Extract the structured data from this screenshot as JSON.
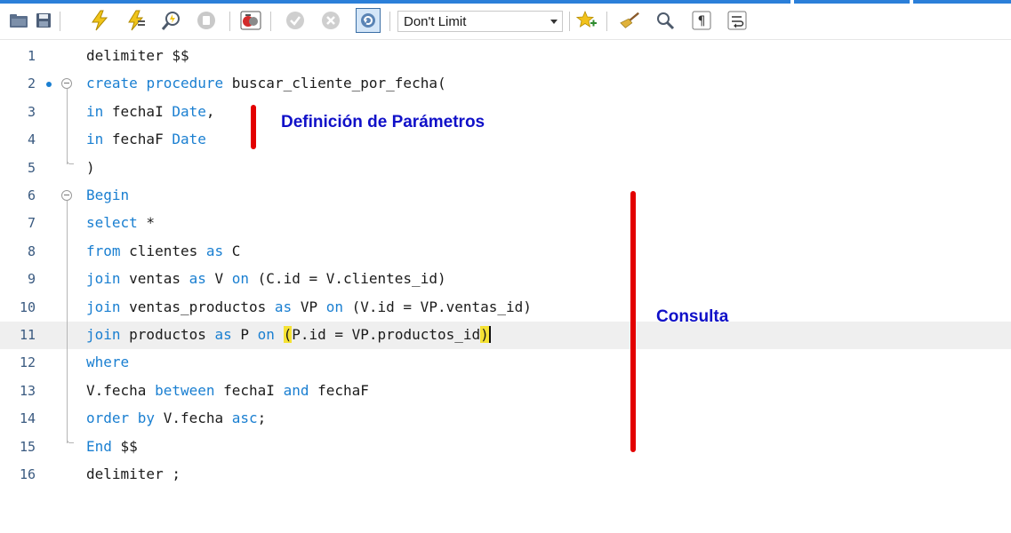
{
  "toolbar": {
    "limit_select_value": "Don't Limit",
    "icons": [
      "open-folder-icon",
      "save-icon",
      "execute-icon",
      "execute-current-icon",
      "explain-icon",
      "stop-icon",
      "toggle-errors-icon",
      "commit-icon",
      "rollback-icon",
      "autocommit-icon",
      "add-snippet-icon",
      "beautify-icon",
      "find-icon",
      "invisible-chars-icon",
      "wrap-lines-icon"
    ]
  },
  "editor": {
    "lines": [
      {
        "num": "1",
        "tokens": [
          {
            "t": "delimiter $$",
            "c": "plain"
          }
        ]
      },
      {
        "num": "2",
        "tokens": [
          {
            "t": "create",
            "c": "kw"
          },
          {
            "t": " ",
            "c": "plain"
          },
          {
            "t": "procedure",
            "c": "kw"
          },
          {
            "t": " buscar_cliente_por_fecha(",
            "c": "plain"
          }
        ]
      },
      {
        "num": "3",
        "tokens": [
          {
            "t": "in",
            "c": "kw"
          },
          {
            "t": " fechaI ",
            "c": "plain"
          },
          {
            "t": "Date",
            "c": "kw"
          },
          {
            "t": ",",
            "c": "plain"
          }
        ]
      },
      {
        "num": "4",
        "tokens": [
          {
            "t": "in",
            "c": "kw"
          },
          {
            "t": " fechaF ",
            "c": "plain"
          },
          {
            "t": "Date",
            "c": "kw"
          }
        ]
      },
      {
        "num": "5",
        "tokens": [
          {
            "t": ")",
            "c": "plain"
          }
        ]
      },
      {
        "num": "6",
        "tokens": [
          {
            "t": "Begin",
            "c": "kw"
          }
        ]
      },
      {
        "num": "7",
        "tokens": [
          {
            "t": "select",
            "c": "kw"
          },
          {
            "t": " *",
            "c": "plain"
          }
        ]
      },
      {
        "num": "8",
        "tokens": [
          {
            "t": "from",
            "c": "kw"
          },
          {
            "t": " clientes ",
            "c": "plain"
          },
          {
            "t": "as",
            "c": "kw"
          },
          {
            "t": " C",
            "c": "plain"
          }
        ]
      },
      {
        "num": "9",
        "tokens": [
          {
            "t": "join",
            "c": "kw"
          },
          {
            "t": " ventas ",
            "c": "plain"
          },
          {
            "t": "as",
            "c": "kw"
          },
          {
            "t": " V ",
            "c": "plain"
          },
          {
            "t": "on",
            "c": "kw"
          },
          {
            "t": " (C.id = V.clientes_id)",
            "c": "plain"
          }
        ]
      },
      {
        "num": "10",
        "tokens": [
          {
            "t": "join",
            "c": "kw"
          },
          {
            "t": " ventas_productos ",
            "c": "plain"
          },
          {
            "t": "as",
            "c": "kw"
          },
          {
            "t": " VP ",
            "c": "plain"
          },
          {
            "t": "on",
            "c": "kw"
          },
          {
            "t": " (V.id = VP.ventas_id)",
            "c": "plain"
          }
        ]
      },
      {
        "num": "11",
        "tokens": [
          {
            "t": "join",
            "c": "kw"
          },
          {
            "t": " productos ",
            "c": "plain"
          },
          {
            "t": "as",
            "c": "kw"
          },
          {
            "t": " P ",
            "c": "plain"
          },
          {
            "t": "on",
            "c": "kw"
          },
          {
            "t": " ",
            "c": "plain"
          },
          {
            "t": "(",
            "c": "paren-hl"
          },
          {
            "t": "P.id = VP.productos_id",
            "c": "plain"
          },
          {
            "t": ")",
            "c": "paren-hl-right"
          }
        ]
      },
      {
        "num": "12",
        "tokens": [
          {
            "t": "where",
            "c": "kw"
          }
        ]
      },
      {
        "num": "13",
        "tokens": [
          {
            "t": "V.fecha ",
            "c": "plain"
          },
          {
            "t": "between",
            "c": "kw"
          },
          {
            "t": " fechaI ",
            "c": "plain"
          },
          {
            "t": "and",
            "c": "kw"
          },
          {
            "t": " fechaF",
            "c": "plain"
          }
        ]
      },
      {
        "num": "14",
        "tokens": [
          {
            "t": "order by",
            "c": "kw"
          },
          {
            "t": " V.fecha ",
            "c": "plain"
          },
          {
            "t": "asc",
            "c": "kw"
          },
          {
            "t": ";",
            "c": "plain"
          }
        ]
      },
      {
        "num": "15",
        "tokens": [
          {
            "t": "End",
            "c": "kw"
          },
          {
            "t": " $$",
            "c": "plain"
          }
        ]
      },
      {
        "num": "16",
        "tokens": [
          {
            "t": "delimiter ;",
            "c": "plain"
          }
        ]
      }
    ],
    "current_line": "11",
    "marker_line": "2"
  },
  "annotations": {
    "params_label": "Definición de Parámetros",
    "query_label": "Consulta",
    "accent_color": "#e30000",
    "label_color": "#1010c8"
  }
}
